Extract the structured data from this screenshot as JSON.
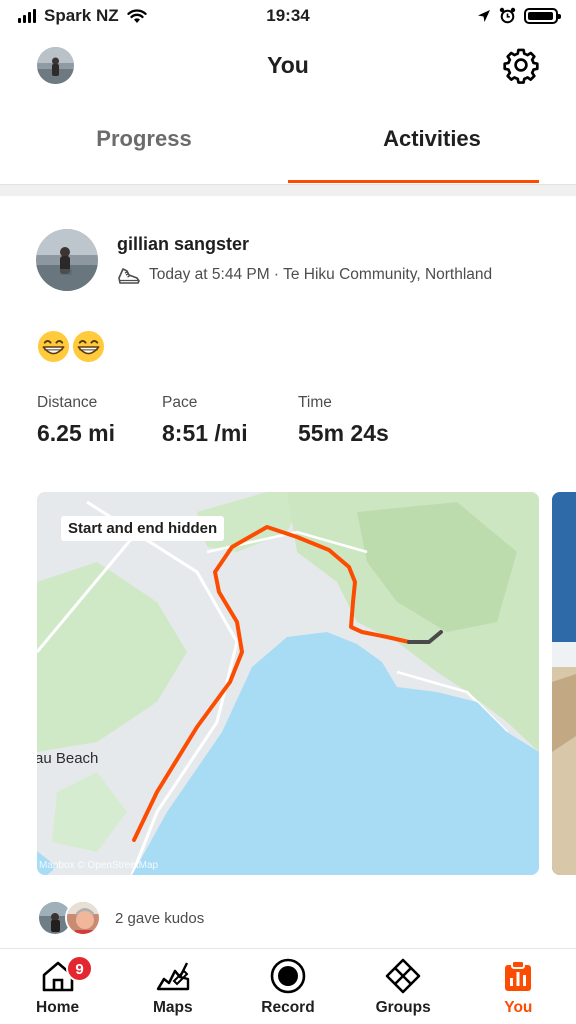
{
  "status_bar": {
    "carrier": "Spark NZ",
    "time": "19:34",
    "battery_level": 0.95
  },
  "header": {
    "title": "You"
  },
  "tabs": [
    {
      "label": "Progress",
      "selected": false
    },
    {
      "label": "Activities",
      "selected": true
    }
  ],
  "activity": {
    "athlete_name": "gillian sangster",
    "meta": "Today at 5:44 PM · Te Hiku Community, Northland",
    "activity_type_icon": "shoe-icon",
    "emoji": [
      "grinning-face",
      "grinning-face"
    ],
    "stats": [
      {
        "label": "Distance",
        "value": "6.25 mi"
      },
      {
        "label": "Pace",
        "value": "8:51 /mi"
      },
      {
        "label": "Time",
        "value": "55m 24s"
      }
    ],
    "map": {
      "badge": "Start and end hidden",
      "place_label": "au Beach",
      "attribution": "Mapbox © OpenStreetMap",
      "route_color": "#fc4c02",
      "water_color": "#a8dcf5"
    },
    "kudos_text": "2 gave kudos"
  },
  "tabbar": {
    "items": [
      {
        "label": "Home",
        "icon": "home-icon",
        "badge": "9",
        "active": false
      },
      {
        "label": "Maps",
        "icon": "maps-icon",
        "active": false
      },
      {
        "label": "Record",
        "icon": "record-icon",
        "active": false
      },
      {
        "label": "Groups",
        "icon": "groups-icon",
        "active": false
      },
      {
        "label": "You",
        "icon": "you-icon",
        "active": true
      }
    ]
  },
  "colors": {
    "accent": "#fc4c02",
    "badge": "#e3262f"
  }
}
